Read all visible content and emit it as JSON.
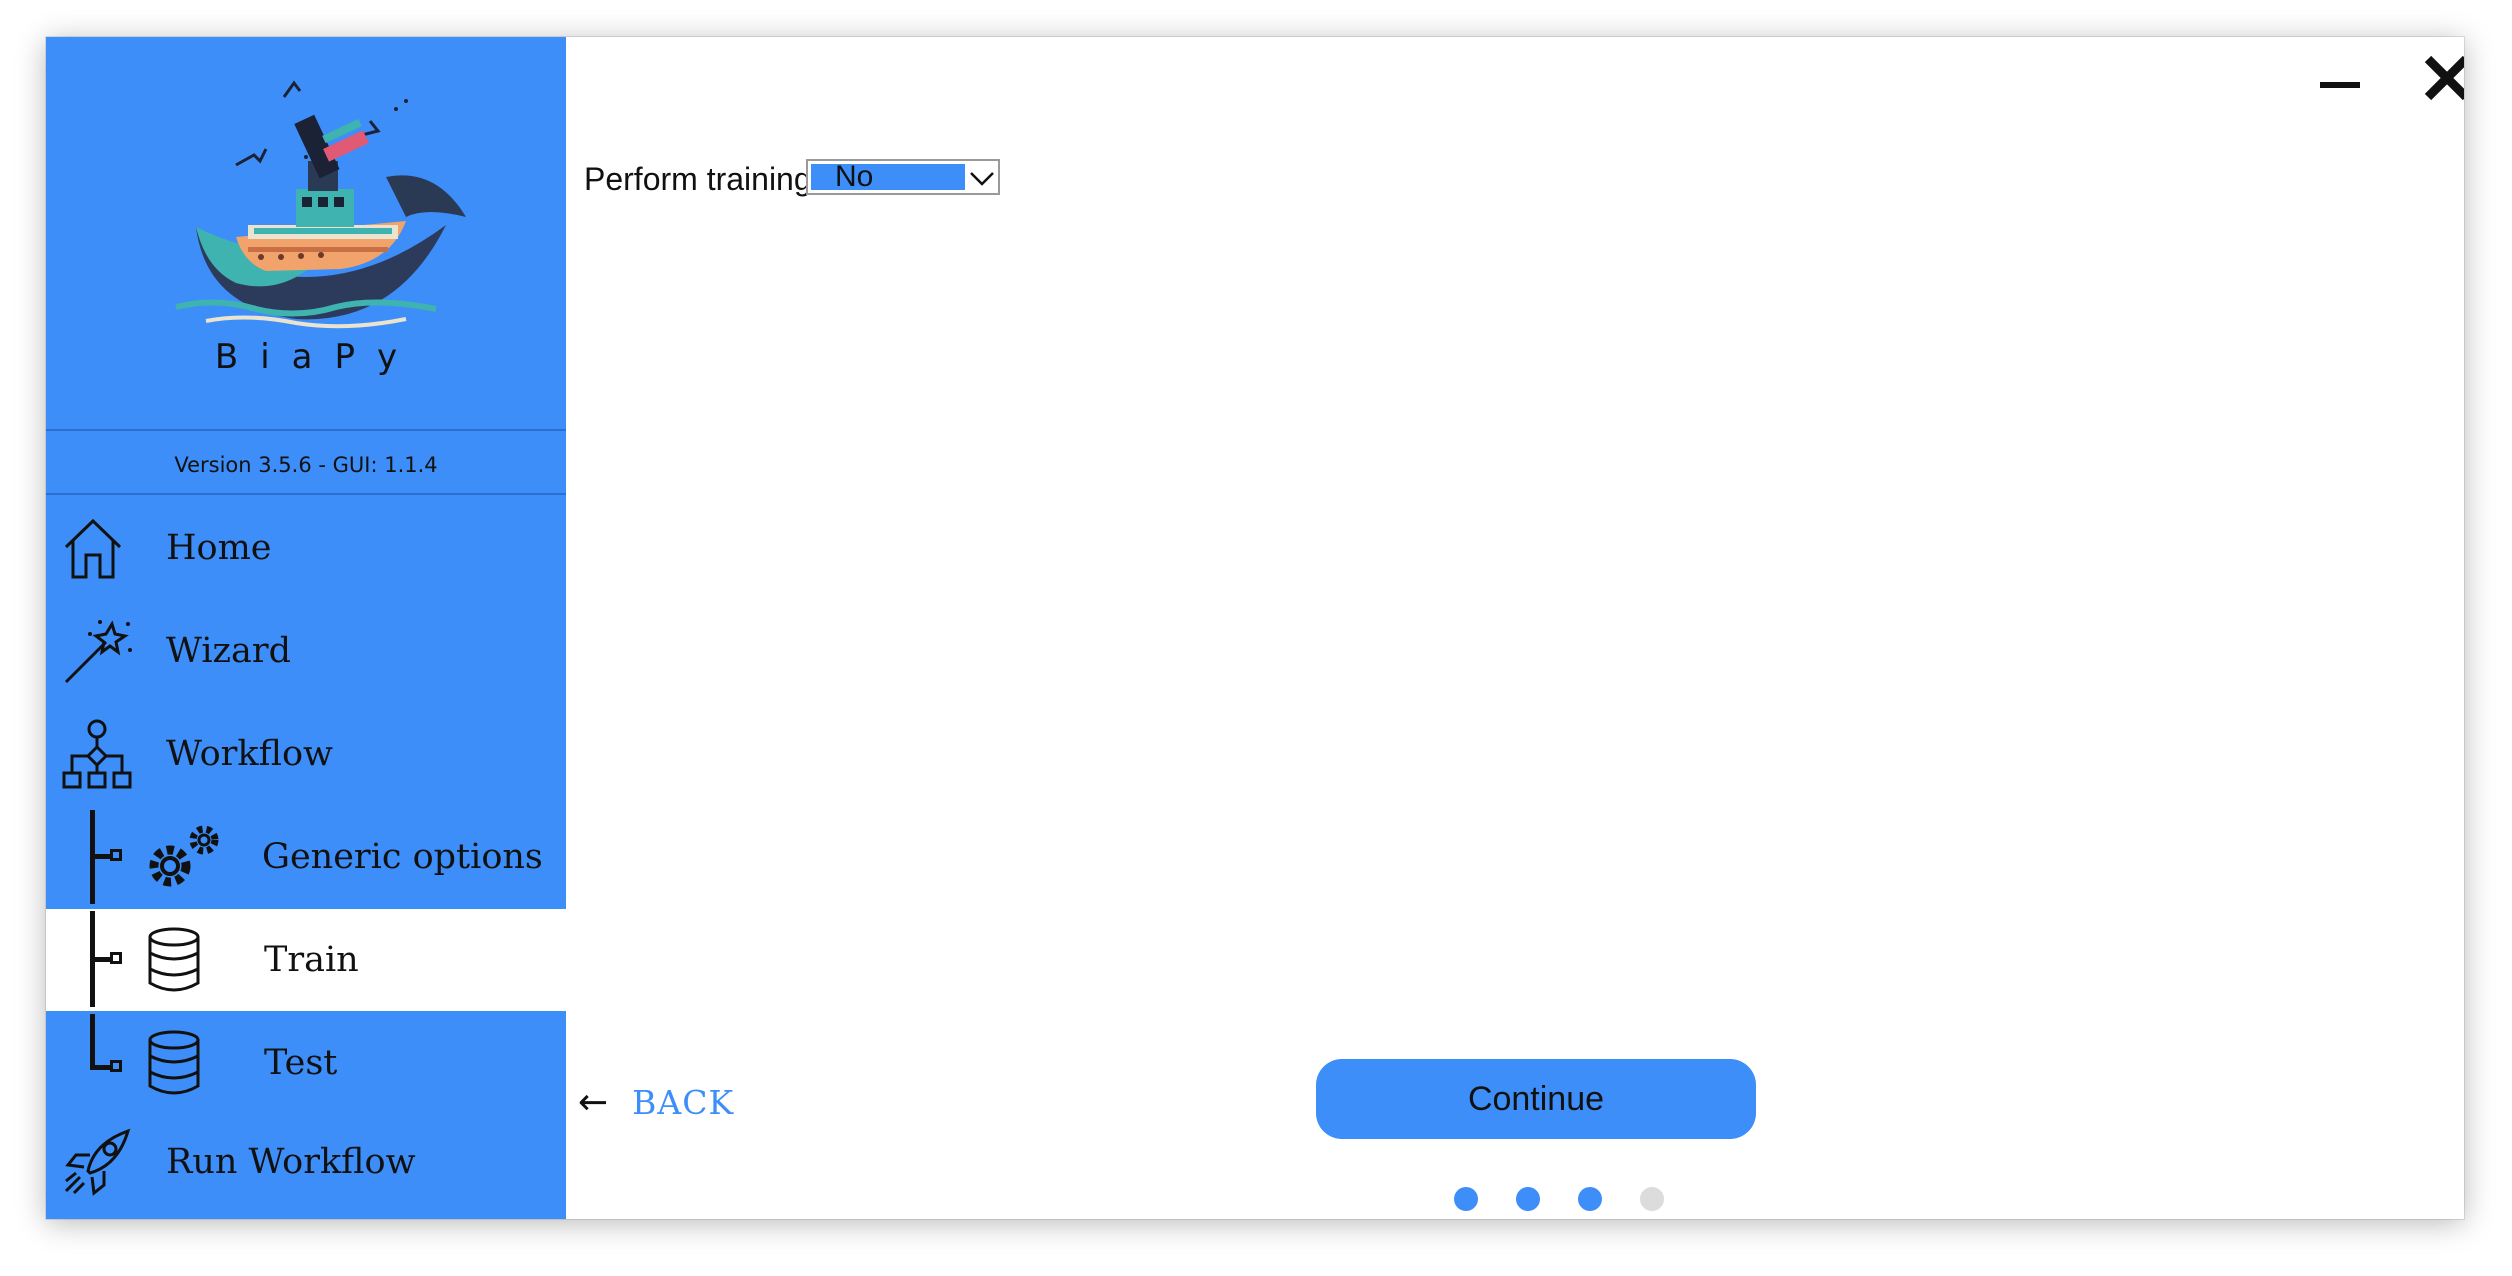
{
  "app": {
    "name": "BiaPy",
    "version": "Version 3.5.6 - GUI: 1.1.4"
  },
  "sidebar": {
    "items": [
      {
        "label": "Home",
        "icon": "home-icon"
      },
      {
        "label": "Wizard",
        "icon": "magic-wand-icon"
      },
      {
        "label": "Workflow",
        "icon": "workflow-icon"
      },
      {
        "label": "Generic options",
        "icon": "gears-icon"
      },
      {
        "label": "Train",
        "icon": "database-icon",
        "active": true
      },
      {
        "label": "Test",
        "icon": "database-icon"
      },
      {
        "label": "Run Workflow",
        "icon": "rocket-icon"
      }
    ]
  },
  "window_controls": {
    "minimize_icon": "minimize-icon",
    "close_icon": "close-icon"
  },
  "main": {
    "perform_training_label": "Perform training",
    "perform_training_value": "No",
    "back_label": "BACK",
    "back_arrow": "←",
    "continue_label": "Continue",
    "progress": {
      "current_step": 3,
      "total_steps": 4
    }
  },
  "colors": {
    "accent": "#3d8ef8",
    "inactive_dot": "#dcdcdc",
    "text": "#111111"
  }
}
